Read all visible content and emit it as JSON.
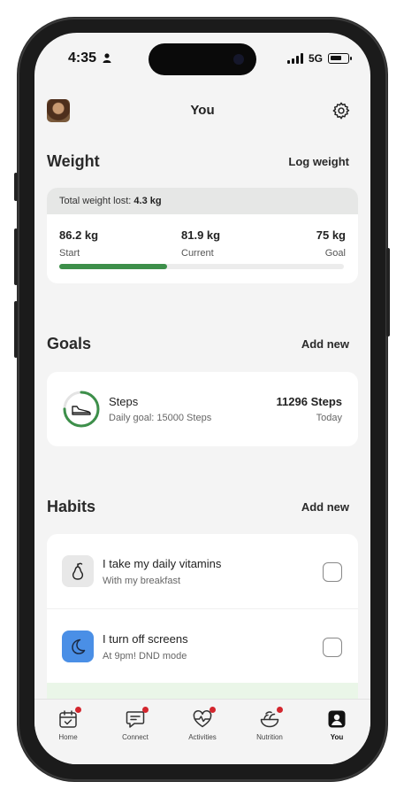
{
  "status_bar": {
    "time": "4:35",
    "network": "5G"
  },
  "header": {
    "title": "You"
  },
  "weight": {
    "title": "Weight",
    "action": "Log weight",
    "total_lost_label": "Total weight lost:",
    "total_lost_value": "4.3 kg",
    "start": {
      "value": "86.2 kg",
      "label": "Start"
    },
    "current": {
      "value": "81.9 kg",
      "label": "Current"
    },
    "goal": {
      "value": "75 kg",
      "label": "Goal"
    },
    "progress_fraction": 0.38,
    "progress_color": "#3d8f4a"
  },
  "goals": {
    "title": "Goals",
    "action": "Add new",
    "items": [
      {
        "name": "Steps",
        "subtitle": "Daily goal:  15000 Steps",
        "value": "11296 Steps",
        "when": "Today",
        "icon": "shoe-icon",
        "progress_fraction": 0.75
      }
    ]
  },
  "habits": {
    "title": "Habits",
    "action": "Add new",
    "items": [
      {
        "name": "I take my daily vitamins",
        "subtitle": "With my breakfast",
        "icon": "pear-icon",
        "icon_bg": "#e8e8e8",
        "checked": false
      },
      {
        "name": "I turn off screens",
        "subtitle": "At 9pm! DND mode",
        "icon": "moon-icon",
        "icon_bg": "#4a8fe6",
        "checked": false
      }
    ]
  },
  "tabbar": {
    "items": [
      {
        "label": "Home",
        "icon": "calendar-check-icon",
        "badge": true
      },
      {
        "label": "Connect",
        "icon": "chat-icon",
        "badge": true
      },
      {
        "label": "Activities",
        "icon": "heart-pulse-icon",
        "badge": true
      },
      {
        "label": "Nutrition",
        "icon": "food-bowl-icon",
        "badge": true
      },
      {
        "label": "You",
        "icon": "profile-icon",
        "badge": false,
        "active": true
      }
    ]
  },
  "colors": {
    "accent_green": "#3d8f4a",
    "badge_red": "#d3262e",
    "background": "#f4f4f4"
  }
}
